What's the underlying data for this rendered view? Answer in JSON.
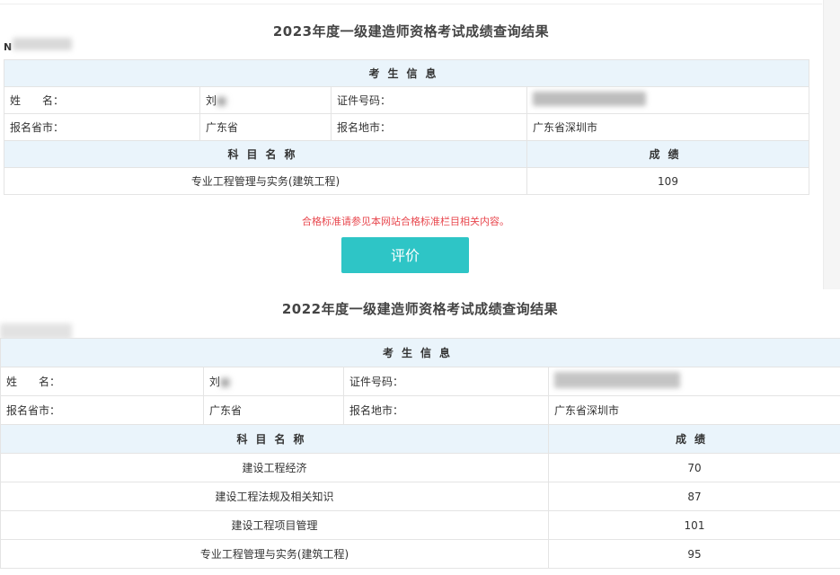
{
  "notice": "合格标准请参见本网站合格标准栏目相关内容。",
  "evaluate_button": "评价",
  "results": [
    {
      "title": "2023年度一级建造师资格考试成绩查询结果",
      "id_prefix": "N",
      "info_header": "考生信息",
      "name_label": "姓　　名：",
      "name_value": "刘",
      "id_label": "证件号码：",
      "province_label": "报名省市：",
      "province_value": "广东省",
      "city_label": "报名地市：",
      "city_value": "广东省深圳市",
      "subject_header": "科目名称",
      "score_header": "成绩",
      "subjects": [
        {
          "name": "专业工程管理与实务(建筑工程)",
          "score": "109"
        }
      ]
    },
    {
      "title": "2022年度一级建造师资格考试成绩查询结果",
      "info_header": "考生信息",
      "name_label": "姓　　名：",
      "name_value": "刘",
      "id_label": "证件号码：",
      "province_label": "报名省市：",
      "province_value": "广东省",
      "city_label": "报名地市：",
      "city_value": "广东省深圳市",
      "subject_header": "科目名称",
      "score_header": "成绩",
      "subjects": [
        {
          "name": "建设工程经济",
          "score": "70"
        },
        {
          "name": "建设工程法规及相关知识",
          "score": "87"
        },
        {
          "name": "建设工程项目管理",
          "score": "101"
        },
        {
          "name": "专业工程管理与实务(建筑工程)",
          "score": "95"
        }
      ]
    }
  ]
}
